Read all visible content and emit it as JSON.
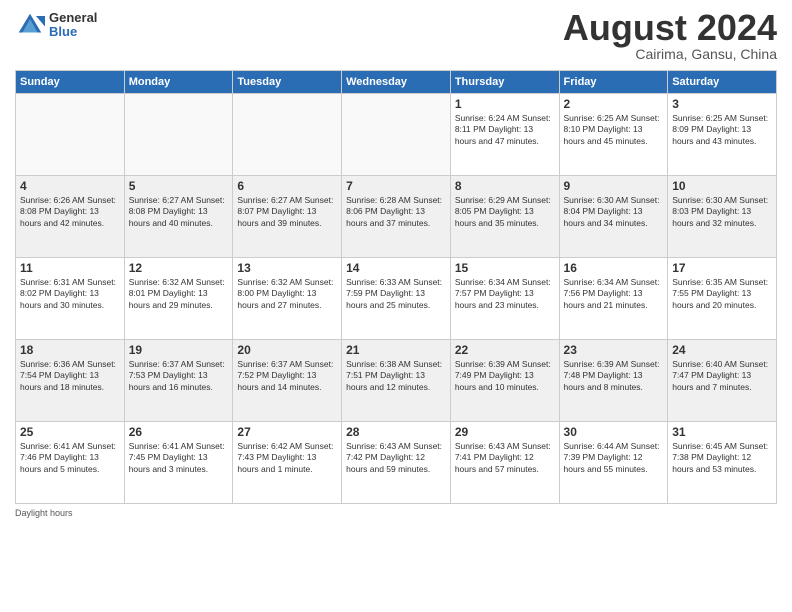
{
  "logo": {
    "general": "General",
    "blue": "Blue"
  },
  "header": {
    "title": "August 2024",
    "location": "Cairima, Gansu, China"
  },
  "days": [
    "Sunday",
    "Monday",
    "Tuesday",
    "Wednesday",
    "Thursday",
    "Friday",
    "Saturday"
  ],
  "footer": {
    "note": "Daylight hours"
  },
  "weeks": [
    [
      {
        "day": "",
        "info": ""
      },
      {
        "day": "",
        "info": ""
      },
      {
        "day": "",
        "info": ""
      },
      {
        "day": "",
        "info": ""
      },
      {
        "day": "1",
        "info": "Sunrise: 6:24 AM\nSunset: 8:11 PM\nDaylight: 13 hours\nand 47 minutes."
      },
      {
        "day": "2",
        "info": "Sunrise: 6:25 AM\nSunset: 8:10 PM\nDaylight: 13 hours\nand 45 minutes."
      },
      {
        "day": "3",
        "info": "Sunrise: 6:25 AM\nSunset: 8:09 PM\nDaylight: 13 hours\nand 43 minutes."
      }
    ],
    [
      {
        "day": "4",
        "info": "Sunrise: 6:26 AM\nSunset: 8:08 PM\nDaylight: 13 hours\nand 42 minutes."
      },
      {
        "day": "5",
        "info": "Sunrise: 6:27 AM\nSunset: 8:08 PM\nDaylight: 13 hours\nand 40 minutes."
      },
      {
        "day": "6",
        "info": "Sunrise: 6:27 AM\nSunset: 8:07 PM\nDaylight: 13 hours\nand 39 minutes."
      },
      {
        "day": "7",
        "info": "Sunrise: 6:28 AM\nSunset: 8:06 PM\nDaylight: 13 hours\nand 37 minutes."
      },
      {
        "day": "8",
        "info": "Sunrise: 6:29 AM\nSunset: 8:05 PM\nDaylight: 13 hours\nand 35 minutes."
      },
      {
        "day": "9",
        "info": "Sunrise: 6:30 AM\nSunset: 8:04 PM\nDaylight: 13 hours\nand 34 minutes."
      },
      {
        "day": "10",
        "info": "Sunrise: 6:30 AM\nSunset: 8:03 PM\nDaylight: 13 hours\nand 32 minutes."
      }
    ],
    [
      {
        "day": "11",
        "info": "Sunrise: 6:31 AM\nSunset: 8:02 PM\nDaylight: 13 hours\nand 30 minutes."
      },
      {
        "day": "12",
        "info": "Sunrise: 6:32 AM\nSunset: 8:01 PM\nDaylight: 13 hours\nand 29 minutes."
      },
      {
        "day": "13",
        "info": "Sunrise: 6:32 AM\nSunset: 8:00 PM\nDaylight: 13 hours\nand 27 minutes."
      },
      {
        "day": "14",
        "info": "Sunrise: 6:33 AM\nSunset: 7:59 PM\nDaylight: 13 hours\nand 25 minutes."
      },
      {
        "day": "15",
        "info": "Sunrise: 6:34 AM\nSunset: 7:57 PM\nDaylight: 13 hours\nand 23 minutes."
      },
      {
        "day": "16",
        "info": "Sunrise: 6:34 AM\nSunset: 7:56 PM\nDaylight: 13 hours\nand 21 minutes."
      },
      {
        "day": "17",
        "info": "Sunrise: 6:35 AM\nSunset: 7:55 PM\nDaylight: 13 hours\nand 20 minutes."
      }
    ],
    [
      {
        "day": "18",
        "info": "Sunrise: 6:36 AM\nSunset: 7:54 PM\nDaylight: 13 hours\nand 18 minutes."
      },
      {
        "day": "19",
        "info": "Sunrise: 6:37 AM\nSunset: 7:53 PM\nDaylight: 13 hours\nand 16 minutes."
      },
      {
        "day": "20",
        "info": "Sunrise: 6:37 AM\nSunset: 7:52 PM\nDaylight: 13 hours\nand 14 minutes."
      },
      {
        "day": "21",
        "info": "Sunrise: 6:38 AM\nSunset: 7:51 PM\nDaylight: 13 hours\nand 12 minutes."
      },
      {
        "day": "22",
        "info": "Sunrise: 6:39 AM\nSunset: 7:49 PM\nDaylight: 13 hours\nand 10 minutes."
      },
      {
        "day": "23",
        "info": "Sunrise: 6:39 AM\nSunset: 7:48 PM\nDaylight: 13 hours\nand 8 minutes."
      },
      {
        "day": "24",
        "info": "Sunrise: 6:40 AM\nSunset: 7:47 PM\nDaylight: 13 hours\nand 7 minutes."
      }
    ],
    [
      {
        "day": "25",
        "info": "Sunrise: 6:41 AM\nSunset: 7:46 PM\nDaylight: 13 hours\nand 5 minutes."
      },
      {
        "day": "26",
        "info": "Sunrise: 6:41 AM\nSunset: 7:45 PM\nDaylight: 13 hours\nand 3 minutes."
      },
      {
        "day": "27",
        "info": "Sunrise: 6:42 AM\nSunset: 7:43 PM\nDaylight: 13 hours\nand 1 minute."
      },
      {
        "day": "28",
        "info": "Sunrise: 6:43 AM\nSunset: 7:42 PM\nDaylight: 12 hours\nand 59 minutes."
      },
      {
        "day": "29",
        "info": "Sunrise: 6:43 AM\nSunset: 7:41 PM\nDaylight: 12 hours\nand 57 minutes."
      },
      {
        "day": "30",
        "info": "Sunrise: 6:44 AM\nSunset: 7:39 PM\nDaylight: 12 hours\nand 55 minutes."
      },
      {
        "day": "31",
        "info": "Sunrise: 6:45 AM\nSunset: 7:38 PM\nDaylight: 12 hours\nand 53 minutes."
      }
    ]
  ]
}
